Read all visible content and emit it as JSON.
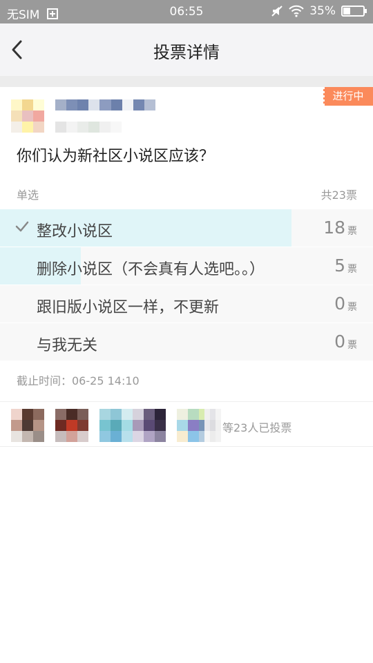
{
  "status_bar": {
    "carrier": "无SIM",
    "time": "06:55",
    "battery": "35%",
    "battery_level": 0.35
  },
  "nav": {
    "title": "投票详情"
  },
  "poll": {
    "status": "进行中",
    "question": "你们认为新社区小说区应该？",
    "type": "单选",
    "total": "共23票",
    "unit": "票",
    "options": [
      {
        "label": "整改小说区",
        "count": "18",
        "selected": true,
        "share": 0.7826
      },
      {
        "label": "删除小说区（不会真有人选吧。。）",
        "count": "5",
        "selected": false,
        "share": 0.2174
      },
      {
        "label": "跟旧版小说区一样，不更新",
        "count": "0",
        "selected": false,
        "share": 0
      },
      {
        "label": "与我无关",
        "count": "0",
        "selected": false,
        "share": 0
      }
    ],
    "deadline": "截止时间：06-25 14:10"
  },
  "voters": {
    "text": "等23人已投票",
    "count_shown": 6
  },
  "colors": {
    "status_tag": "#fb8a5b",
    "vote_bar": "#e0f5f8",
    "option_bg": "#f8f8f8",
    "nav_bg": "#f4f4f6"
  },
  "icons": {
    "back": "chevron-left-icon",
    "check": "check-icon",
    "sim": "sim-icon",
    "mute": "mute-icon",
    "wifi": "wifi-icon",
    "battery": "battery-icon"
  }
}
